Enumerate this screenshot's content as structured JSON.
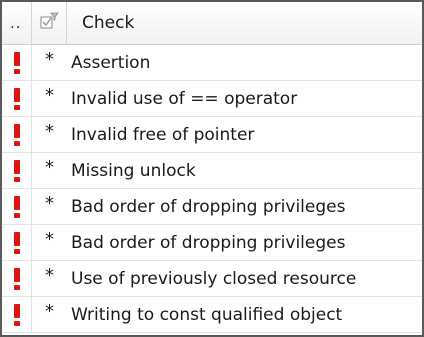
{
  "header": {
    "col1_label": "..",
    "col2_icon": "checkbox-filter-icon",
    "col3_label": "Check"
  },
  "rows": [
    {
      "severity_icon": "error-exclamation-icon",
      "marker": "*",
      "check": "Assertion"
    },
    {
      "severity_icon": "error-exclamation-icon",
      "marker": "*",
      "check": "Invalid use of == operator"
    },
    {
      "severity_icon": "error-exclamation-icon",
      "marker": "*",
      "check": "Invalid free of pointer"
    },
    {
      "severity_icon": "error-exclamation-icon",
      "marker": "*",
      "check": "Missing unlock"
    },
    {
      "severity_icon": "error-exclamation-icon",
      "marker": "*",
      "check": "Bad order of dropping privileges"
    },
    {
      "severity_icon": "error-exclamation-icon",
      "marker": "*",
      "check": "Bad order of dropping privileges"
    },
    {
      "severity_icon": "error-exclamation-icon",
      "marker": "*",
      "check": "Use of previously closed resource"
    },
    {
      "severity_icon": "error-exclamation-icon",
      "marker": "*",
      "check": "Writing to const qualified object"
    }
  ],
  "colors": {
    "severity": "#e0140f"
  }
}
